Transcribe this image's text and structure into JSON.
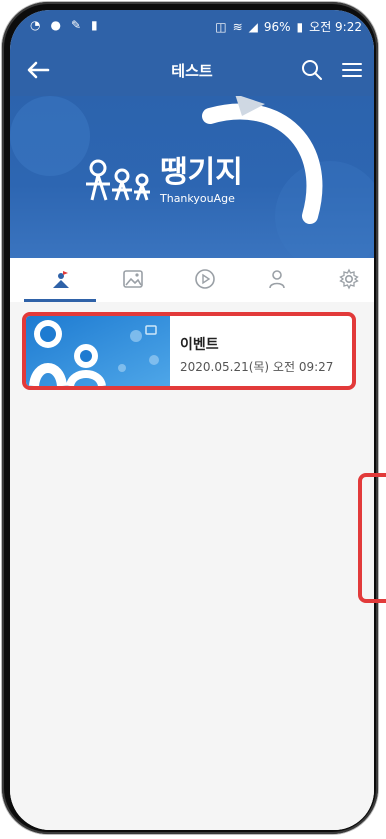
{
  "status": {
    "battery": "96%",
    "time": "오전 9:22"
  },
  "appbar": {
    "title": "테스트"
  },
  "banner": {
    "brand_ko": "땡기지",
    "brand_en": "ThankyouAge"
  },
  "tabs": [
    {
      "icon": "person-flag-icon",
      "active": true
    },
    {
      "icon": "image-icon",
      "active": false
    },
    {
      "icon": "play-icon",
      "active": false
    },
    {
      "icon": "user-icon",
      "active": false
    },
    {
      "icon": "gear-icon",
      "active": false
    }
  ],
  "list": {
    "items": [
      {
        "title": "이벤트",
        "date": "2020.05.21(목) 오전 09:27"
      }
    ]
  },
  "colors": {
    "primary": "#2f62a8",
    "highlight": "#e23a3a"
  }
}
